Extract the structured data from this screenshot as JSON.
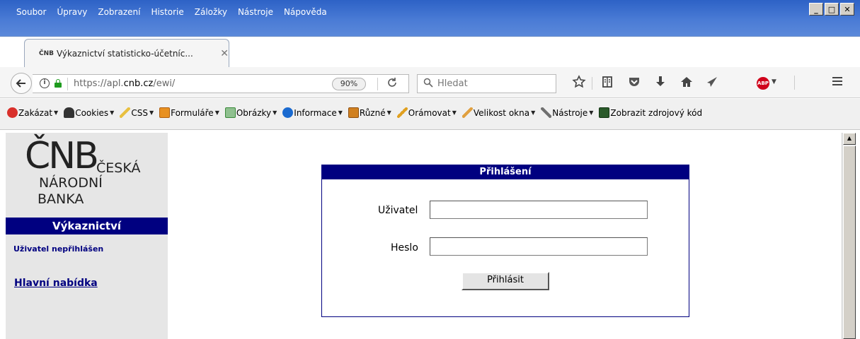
{
  "menu": {
    "items": [
      {
        "label": "Soubor"
      },
      {
        "label": "Úpravy"
      },
      {
        "label": "Zobrazení"
      },
      {
        "label": "Historie"
      },
      {
        "label": "Záložky"
      },
      {
        "label": "Nástroje"
      },
      {
        "label": "Nápověda"
      }
    ]
  },
  "window_controls": {
    "minimize": "_",
    "maximize": "□",
    "close": "✕"
  },
  "tab": {
    "favicon": "ČNB",
    "title": "Výkaznictví statisticko-účetníc...",
    "close": "✕",
    "new_tab": "+"
  },
  "navbar": {
    "url_prefix": "https://apl.",
    "url_host": "cnb.cz",
    "url_path": "/ewi/",
    "zoom": "90%",
    "search_placeholder": "Hledat",
    "icons": [
      "back-arrow-icon",
      "info-icon",
      "lock-icon",
      "reload-icon",
      "search-icon",
      "bookmark-star-icon",
      "reading-list-icon",
      "pocket-icon",
      "download-icon",
      "home-icon",
      "send-icon",
      "adblock-icon",
      "hamburger-menu-icon"
    ],
    "adblock_label": "ABP"
  },
  "devbar": {
    "items": [
      {
        "label": "Zakázat",
        "color": "#d9302b"
      },
      {
        "label": "Cookies",
        "color": "#333333"
      },
      {
        "label": "CSS",
        "color": "#e8c040"
      },
      {
        "label": "Formuláře",
        "color": "#e89020"
      },
      {
        "label": "Obrázky",
        "color": "#3a8a3a"
      },
      {
        "label": "Informace",
        "color": "#1a6ad0"
      },
      {
        "label": "Různé",
        "color": "#d08020"
      },
      {
        "label": "Orámovat",
        "color": "#e0a020"
      },
      {
        "label": "Velikost okna",
        "color": "#e0a040"
      },
      {
        "label": "Nástroje",
        "color": "#707070"
      },
      {
        "label": "Zobrazit zdrojový kód",
        "color": "#2a5a2a"
      }
    ]
  },
  "sidebar": {
    "logo_cnb": "ČNB",
    "logo_line1": "ČESKÁ",
    "logo_line2": "NÁRODNÍ",
    "logo_line3": "BANKA",
    "section_title": "Výkaznictví",
    "user_status": "Uživatel nepřihlášen",
    "main_menu_link": "Hlavní nabídka"
  },
  "login": {
    "header": "Přihlášení",
    "user_label": "Uživatel",
    "user_value": "",
    "password_label": "Heslo",
    "password_value": "",
    "submit_label": "Přihlásit"
  },
  "colors": {
    "accent_navy": "#000080",
    "sidebar_bg": "#e6e6e6",
    "titlebar_blue": "#4a7bd5"
  }
}
